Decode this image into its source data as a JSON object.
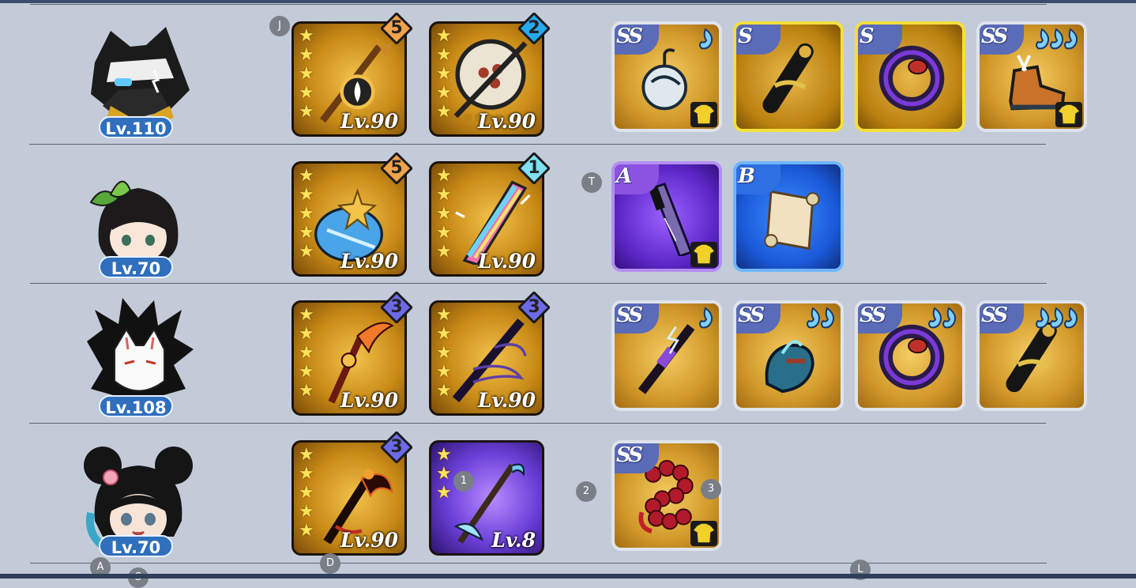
{
  "heroes": [
    {
      "level": "Lv.110",
      "avatar": "badger-ninja-avatar",
      "weapons": [
        {
          "stars": 5,
          "level": "Lv.90",
          "rank": "5",
          "rank_color": "#f2a24a",
          "bg": "gold",
          "icon": "spiral-staff-icon"
        },
        {
          "stars": 5,
          "level": "Lv.90",
          "rank": "2",
          "rank_color": "#27a9f0",
          "bg": "gold",
          "icon": "war-drum-icon"
        }
      ],
      "gear": [
        {
          "grade": "SS",
          "tier": "ss",
          "icon": "bomb-lantern-icon",
          "spirits": 1,
          "equipped": true
        },
        {
          "grade": "S",
          "tier": "s",
          "icon": "scroll-tube-icon",
          "spirits": 0,
          "equipped": false
        },
        {
          "grade": "S",
          "tier": "s",
          "icon": "dark-ring-icon",
          "spirits": 0,
          "equipped": false
        },
        {
          "grade": "SS",
          "tier": "ss",
          "icon": "winged-boot-icon",
          "spirits": 3,
          "equipped": true
        }
      ]
    },
    {
      "level": "Lv.70",
      "avatar": "leaf-girl-avatar",
      "weapons": [
        {
          "stars": 5,
          "level": "Lv.90",
          "rank": "5",
          "rank_color": "#f2a24a",
          "bg": "gold",
          "icon": "ice-mace-icon"
        },
        {
          "stars": 5,
          "level": "Lv.90",
          "rank": "1",
          "rank_color": "#7ee0f0",
          "bg": "gold",
          "icon": "rainbow-blade-icon"
        }
      ],
      "gear": [
        {
          "grade": "A",
          "tier": "a",
          "icon": "talisman-dagger-icon",
          "spirits": 0,
          "equipped": true
        },
        {
          "grade": "B",
          "tier": "b",
          "icon": "parchment-scroll-icon",
          "spirits": 0,
          "equipped": false
        }
      ]
    },
    {
      "level": "Lv.108",
      "avatar": "fox-mask-avatar",
      "weapons": [
        {
          "stars": 5,
          "level": "Lv.90",
          "rank": "3",
          "rank_color": "#6d6ae8",
          "bg": "gold",
          "icon": "flame-sickle-icon"
        },
        {
          "stars": 5,
          "level": "Lv.90",
          "rank": "3",
          "rank_color": "#6d6ae8",
          "bg": "gold",
          "icon": "shadow-katana-icon"
        }
      ],
      "gear": [
        {
          "grade": "SS",
          "tier": "ss",
          "icon": "lightning-dagger-icon",
          "spirits": 1,
          "equipped": false
        },
        {
          "grade": "SS",
          "tier": "ss",
          "icon": "spirit-gauntlet-icon",
          "spirits": 2,
          "equipped": false
        },
        {
          "grade": "SS",
          "tier": "ss",
          "icon": "dark-ring-icon",
          "spirits": 2,
          "equipped": false
        },
        {
          "grade": "SS",
          "tier": "ss",
          "icon": "scroll-tube-icon",
          "spirits": 3,
          "equipped": false
        }
      ]
    },
    {
      "level": "Lv.70",
      "avatar": "bun-hair-girl-avatar",
      "weapons": [
        {
          "stars": 5,
          "level": "Lv.90",
          "rank": "3",
          "rank_color": "#6d6ae8",
          "bg": "gold",
          "icon": "ember-scythe-icon"
        },
        {
          "stars": 3,
          "level": "Lv.8",
          "rank": "",
          "rank_color": "",
          "bg": "purple",
          "icon": "frost-spear-icon"
        }
      ],
      "gear": [
        {
          "grade": "SS",
          "tier": "ss",
          "icon": "prayer-beads-icon",
          "spirits": 0,
          "equipped": true
        }
      ]
    }
  ],
  "markers": [
    {
      "label": "J"
    },
    {
      "label": "T"
    },
    {
      "label": "1"
    },
    {
      "label": "2"
    },
    {
      "label": "3"
    },
    {
      "label": "A"
    },
    {
      "label": "S"
    },
    {
      "label": "D"
    },
    {
      "label": "L"
    }
  ],
  "colors": {
    "background": "#c3cbd9",
    "level_badge": "#2f6fbd",
    "star": "#ffe35a"
  }
}
